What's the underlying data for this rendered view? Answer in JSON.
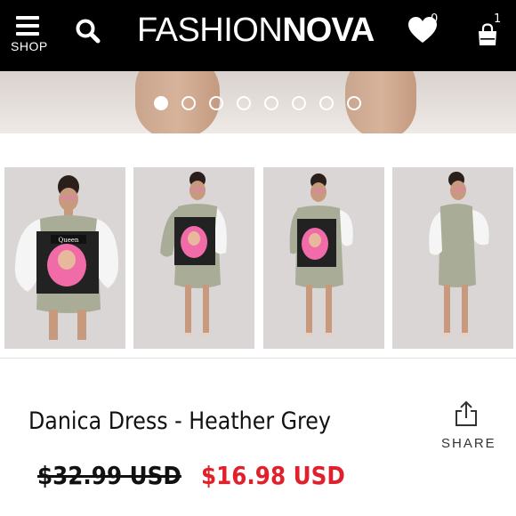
{
  "header": {
    "menu_label": "SHOP",
    "menu_icon": "hamburger-menu-icon",
    "search_icon": "search-icon",
    "logo_light": "FASHION",
    "logo_bold": "NOVA",
    "wishlist_icon": "heart-icon",
    "wishlist_count": "0",
    "cart_icon": "shopping-bag-icon",
    "cart_count": "1",
    "background_color": "#000000"
  },
  "carousel": {
    "slide_count": 8,
    "active_index": 0
  },
  "thumbnails": [
    {
      "alt": "model-front-view"
    },
    {
      "alt": "model-front-view-2"
    },
    {
      "alt": "model-front-view-3"
    },
    {
      "alt": "model-side-view"
    }
  ],
  "product": {
    "title": "Danica Dress - Heather Grey",
    "original_price": "$32.99 USD",
    "sale_price": "$16.98 USD",
    "sale_color": "#e0212b",
    "share_label": "SHARE",
    "share_icon": "share-icon"
  }
}
